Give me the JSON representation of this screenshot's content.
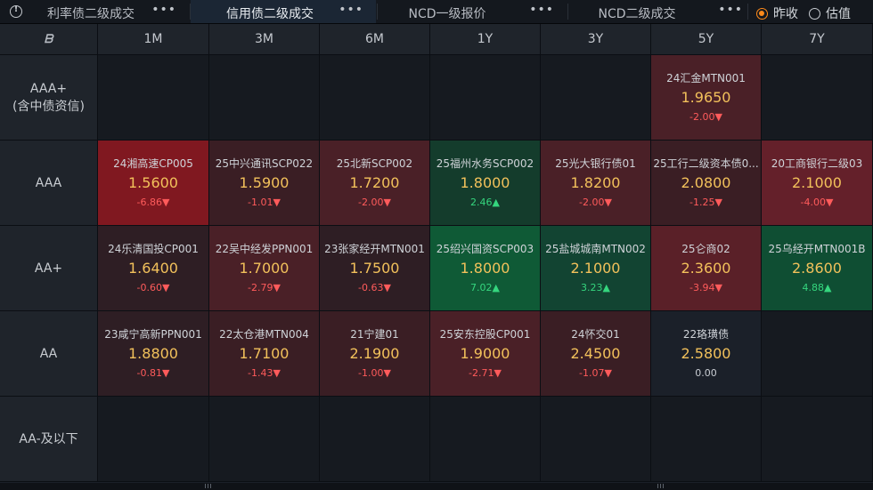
{
  "tabs": [
    {
      "label": "利率债二级成交",
      "active": false
    },
    {
      "label": "信用债二级成交",
      "active": true
    },
    {
      "label": "NCD一级报价",
      "active": false
    },
    {
      "label": "NCD二级成交",
      "active": false
    }
  ],
  "more_label": "•••",
  "options": [
    {
      "label": "昨收",
      "checked": true
    },
    {
      "label": "估值",
      "checked": false
    }
  ],
  "corner_logo": "ᗷ",
  "columns": [
    "1M",
    "3M",
    "6M",
    "1Y",
    "3Y",
    "5Y",
    "7Y"
  ],
  "rows": [
    {
      "label": "AAA+\n(含中债资信)",
      "cells": [
        null,
        null,
        null,
        null,
        null,
        {
          "name": "24汇金MTN001",
          "yield": "1.9650",
          "change": "-2.00▼",
          "dir": "down",
          "color": "#4a2027"
        },
        null
      ]
    },
    {
      "label": "AAA",
      "cells": [
        {
          "name": "24湘高速CP005",
          "yield": "1.5600",
          "change": "-6.86▼",
          "dir": "down",
          "color": "#801820"
        },
        {
          "name": "25中兴通讯SCP022",
          "yield": "1.5900",
          "change": "-1.01▼",
          "dir": "down",
          "color": "#3a1e24"
        },
        {
          "name": "25北新SCP002",
          "yield": "1.7200",
          "change": "-2.00▼",
          "dir": "down",
          "color": "#4a2027"
        },
        {
          "name": "25福州水务SCP002",
          "yield": "1.8000",
          "change": "2.46▲",
          "dir": "up",
          "color": "#143c2c"
        },
        {
          "name": "25光大银行债01",
          "yield": "1.8200",
          "change": "-2.00▼",
          "dir": "down",
          "color": "#4a2027"
        },
        {
          "name": "25工行二级资本债0...",
          "yield": "2.0800",
          "change": "-1.25▼",
          "dir": "down",
          "color": "#3a1e24"
        },
        {
          "name": "20工商银行二级03",
          "yield": "2.1000",
          "change": "-4.00▼",
          "dir": "down",
          "color": "#64202a"
        }
      ]
    },
    {
      "label": "AA+",
      "cells": [
        {
          "name": "24乐清国投CP001",
          "yield": "1.6400",
          "change": "-0.60▼",
          "dir": "down",
          "color": "#2e1e24"
        },
        {
          "name": "22吴中经发PPN001",
          "yield": "1.7000",
          "change": "-2.79▼",
          "dir": "down",
          "color": "#4a2027"
        },
        {
          "name": "23张家经开MTN001",
          "yield": "1.7500",
          "change": "-0.63▼",
          "dir": "down",
          "color": "#2e1e24"
        },
        {
          "name": "25绍兴国资SCP003",
          "yield": "1.8000",
          "change": "7.02▲",
          "dir": "up",
          "color": "#0f5a36"
        },
        {
          "name": "25盐城城南MTN002",
          "yield": "2.1000",
          "change": "3.23▲",
          "dir": "up",
          "color": "#124432"
        },
        {
          "name": "25仑商02",
          "yield": "2.3600",
          "change": "-3.94▼",
          "dir": "down",
          "color": "#5a2028"
        },
        {
          "name": "25乌经开MTN001B",
          "yield": "2.8600",
          "change": "4.88▲",
          "dir": "up",
          "color": "#0f4e33"
        }
      ]
    },
    {
      "label": "AA",
      "cells": [
        {
          "name": "23咸宁高新PPN001",
          "yield": "1.8800",
          "change": "-0.81▼",
          "dir": "down",
          "color": "#2e1e24"
        },
        {
          "name": "22太仓港MTN004",
          "yield": "1.7100",
          "change": "-1.43▼",
          "dir": "down",
          "color": "#3a1e24"
        },
        {
          "name": "21宁建01",
          "yield": "2.1900",
          "change": "-1.00▼",
          "dir": "down",
          "color": "#3a1e24"
        },
        {
          "name": "25安东控股CP001",
          "yield": "1.9000",
          "change": "-2.71▼",
          "dir": "down",
          "color": "#4a2027"
        },
        {
          "name": "24怀交01",
          "yield": "2.4500",
          "change": "-1.07▼",
          "dir": "down",
          "color": "#3a1e24"
        },
        {
          "name": "22珞璜债",
          "yield": "2.5800",
          "change": "0.00",
          "dir": "flat",
          "color": "#1b2029"
        },
        null
      ]
    },
    {
      "label": "AA-及以下",
      "cells": [
        null,
        null,
        null,
        null,
        null,
        null,
        null
      ]
    }
  ]
}
